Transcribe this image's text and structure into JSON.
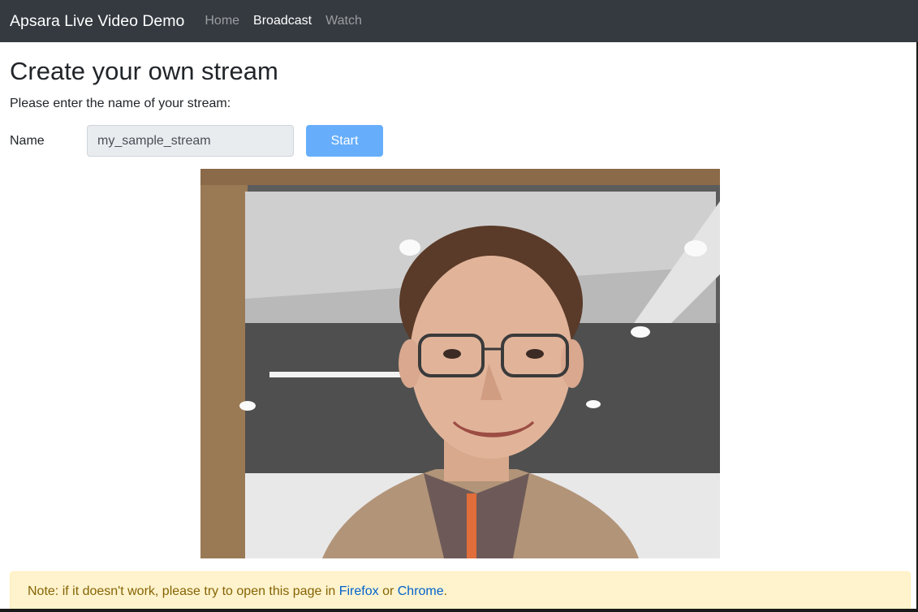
{
  "navbar": {
    "brand": "Apsara Live Video Demo",
    "links": [
      {
        "label": "Home",
        "active": false
      },
      {
        "label": "Broadcast",
        "active": true
      },
      {
        "label": "Watch",
        "active": false
      }
    ]
  },
  "page": {
    "title": "Create your own stream",
    "prompt": "Please enter the name of your stream:",
    "name_label": "Name",
    "name_value": "my_sample_stream",
    "start_label": "Start"
  },
  "alert": {
    "prefix": "Note: if it doesn't work, please try to open this page in ",
    "link1": "Firefox",
    "middle": " or ",
    "link2": "Chrome",
    "suffix": "."
  },
  "colors": {
    "navbar_bg": "#343a40",
    "button_bg": "#66aefb",
    "alert_bg": "#fff3cd",
    "alert_text": "#856404",
    "link": "#0062cc"
  }
}
